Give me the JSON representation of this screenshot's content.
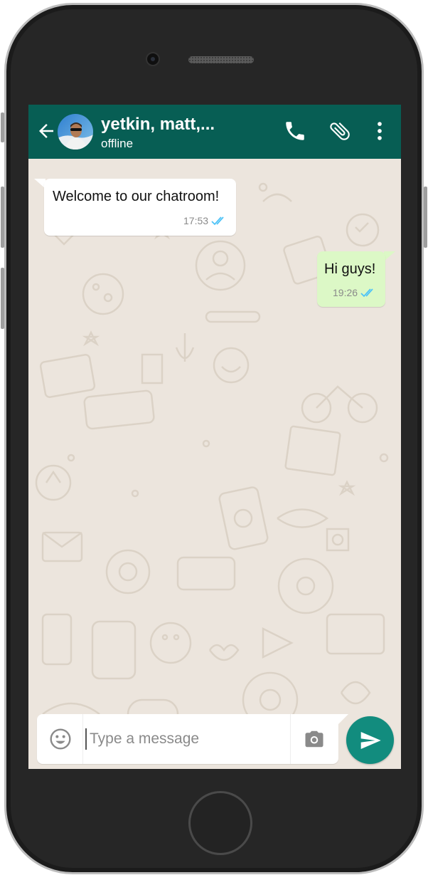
{
  "header": {
    "title": "yetkin, matt,...",
    "status": "offline"
  },
  "messages": [
    {
      "direction": "incoming",
      "text": "Welcome to our chatroom!",
      "time": "17:53",
      "read": true
    },
    {
      "direction": "outgoing",
      "text": "Hi guys!",
      "time": "19:26",
      "read": true
    }
  ],
  "composer": {
    "placeholder": "Type a message"
  },
  "colors": {
    "header": "#075e54",
    "chat_background": "#ece5dd",
    "outgoing_bubble": "#dcf8c6",
    "incoming_bubble": "#ffffff",
    "send_button": "#128c7e",
    "read_ticks": "#4fc3f7"
  },
  "icons": {
    "back": "arrow-left-icon",
    "call": "phone-icon",
    "attach": "paperclip-icon",
    "menu": "more-vert-icon",
    "emoji": "smiley-icon",
    "camera": "camera-icon",
    "send": "send-icon"
  }
}
